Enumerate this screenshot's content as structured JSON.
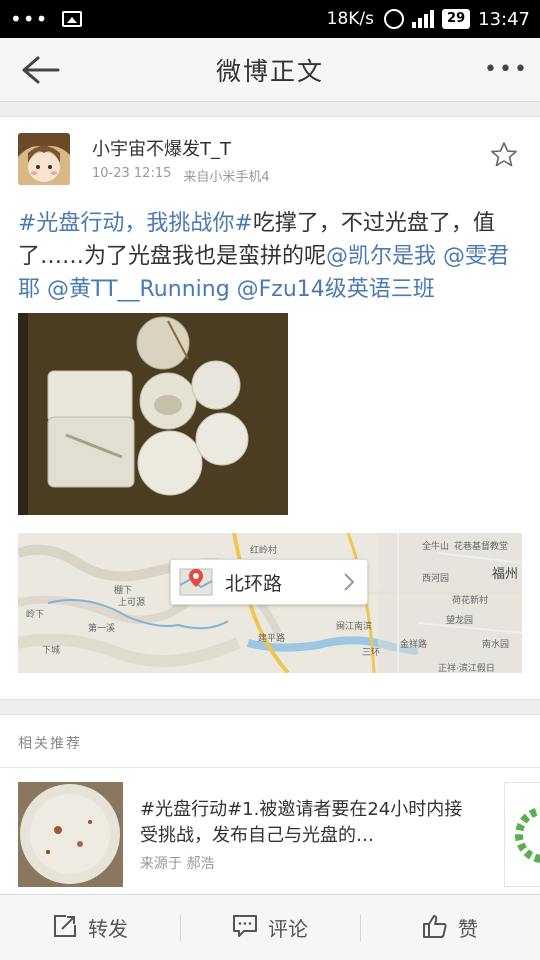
{
  "status_bar": {
    "dots": "•••",
    "net_speed": "18K/s",
    "network": "4G",
    "battery": "29",
    "time": "13:47"
  },
  "title_bar": {
    "title": "微博正文",
    "more": "•••"
  },
  "post": {
    "username": "小宇宙不爆发T_T",
    "date": "10-23  12:15",
    "source": "来自小米手机4",
    "text_segments": [
      {
        "text": "#光盘行动，我挑战你#",
        "highlight": true
      },
      {
        "text": "吃撑了，不过光盘了，值了……为了光盘我也是蛮拼的呢",
        "highlight": false
      },
      {
        "text": "@凯尔是我",
        "highlight": true
      },
      {
        "text": " ",
        "highlight": false
      },
      {
        "text": "@雯君耶",
        "highlight": true
      },
      {
        "text": " ",
        "highlight": false
      },
      {
        "text": "@黄TT__Running",
        "highlight": true
      },
      {
        "text": " ",
        "highlight": false
      },
      {
        "text": "@Fzu14级英语三班",
        "highlight": true
      }
    ],
    "location": "北环路",
    "map_labels": [
      "红岭村",
      "全牛山",
      "花巷基督教堂",
      "西河园",
      "福州",
      "荷花新村",
      "望龙园",
      "闽江南滨",
      "金祥路",
      "南水园",
      "正祥·滨江假日",
      "第一溪",
      "棚下",
      "上可源",
      "下城",
      "建平路",
      "三环",
      "岭下"
    ]
  },
  "related": {
    "heading": "相关推荐",
    "items": [
      {
        "title": "#光盘行动#1.被邀请者要在24小时内接受挑战，发布自己与光盘的…",
        "source": "来源于  郝浩"
      }
    ]
  },
  "bottom_bar": {
    "repost": "转发",
    "comment": "评论",
    "like": "赞"
  },
  "colors": {
    "link": "#4a7ab3",
    "text": "#333333",
    "muted": "#999999"
  }
}
